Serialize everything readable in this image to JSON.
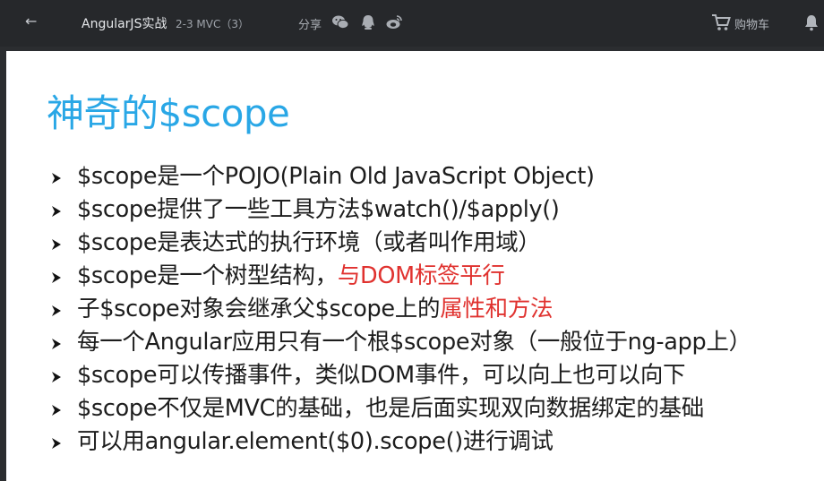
{
  "topbar": {
    "back_icon": "back-arrow-icon",
    "course_title": "AngularJS实战",
    "lesson_title": "2-3 MVC（3）",
    "share_label": "分享",
    "share_icons": [
      "wechat-icon",
      "qq-icon",
      "weibo-icon"
    ],
    "cart_label": "购物车",
    "cart_icon": "cart-icon",
    "notification_icon": "bell-icon"
  },
  "slide": {
    "title": "神奇的$scope",
    "title_color": "#29a7e6",
    "accent_red": "#e0322f",
    "bullets": [
      {
        "text": "$scope是一个POJO(Plain Old JavaScript Object)",
        "red": ""
      },
      {
        "text": "$scope提供了一些工具方法$watch()/$apply()",
        "red": ""
      },
      {
        "text": "$scope是表达式的执行环境（或者叫作用域）",
        "red": ""
      },
      {
        "text": "$scope是一个树型结构，",
        "red": "与DOM标签平行"
      },
      {
        "text": "子$scope对象会继承父$scope上的",
        "red": "属性和方法"
      },
      {
        "text": "每一个Angular应用只有一个根$scope对象（一般位于ng-app上）",
        "red": ""
      },
      {
        "text": "$scope可以传播事件，类似DOM事件，可以向上也可以向下",
        "red": ""
      },
      {
        "text": "$scope不仅是MVC的基础，也是后面实现双向数据绑定的基础",
        "red": ""
      },
      {
        "text": "可以用angular.element($0).scope()进行调试",
        "red": ""
      }
    ]
  }
}
